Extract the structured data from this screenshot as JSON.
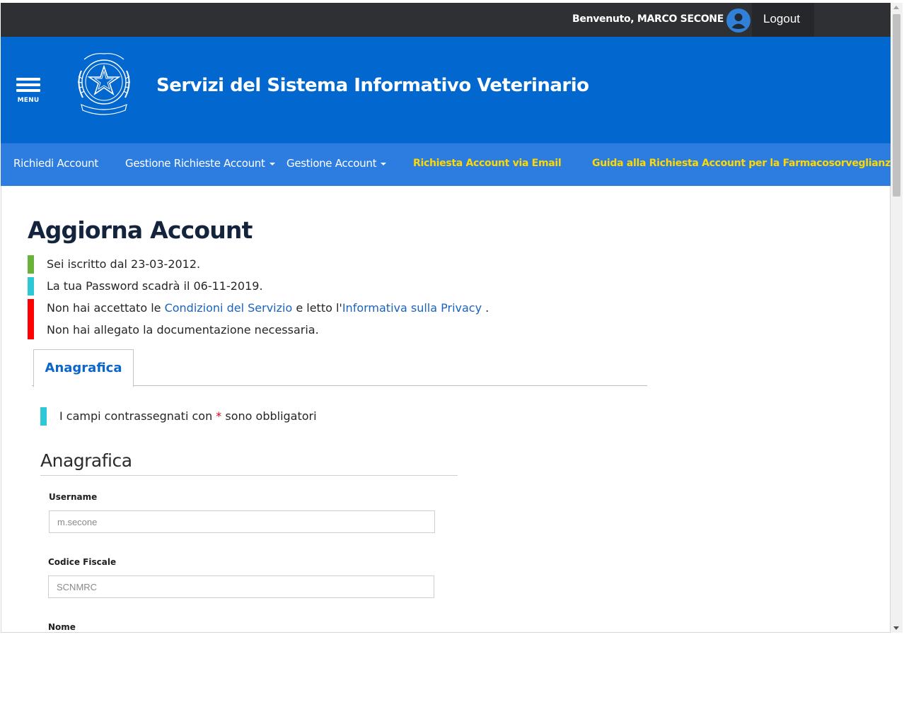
{
  "topbar": {
    "welcome": "Benvenuto, MARCO SECONE",
    "logout": "Logout"
  },
  "header": {
    "menu_label": "MENU",
    "title": "Servizi del Sistema Informativo Veterinario",
    "emblem_icon": "repubblica-italiana-emblem"
  },
  "nav": {
    "items": [
      {
        "label": "Richiedi Account"
      },
      {
        "label": "Gestione Richieste Account"
      },
      {
        "label": "Gestione Account"
      },
      {
        "label": "Richiesta Account via Email"
      },
      {
        "label": "Guida alla Richiesta Account per la Farmacosorveglianza"
      }
    ]
  },
  "page": {
    "title": "Aggiorna Account",
    "alerts": [
      {
        "text": "Sei iscritto dal 23-03-2012.",
        "color": "#6ab33b"
      },
      {
        "text": "La tua Password scadrà il 06-11-2019.",
        "color": "#2ec7d6"
      },
      {
        "pre": "Non hai accettato le ",
        "link1": "Condizioni del Servizio",
        "mid": " e letto l'",
        "link2": "Informativa sulla Privacy",
        "post": " .",
        "color": "#ff0000"
      },
      {
        "text": "Non hai allegato la documentazione necessaria.",
        "color": "#ff0000"
      }
    ],
    "tab": "Anagrafica",
    "required_note_pre": "I campi contrassegnati con ",
    "required_star": "*",
    "required_note_post": " sono obbligatori",
    "section_title": "Anagrafica",
    "fields": [
      {
        "label": "Username",
        "value": "m.secone"
      },
      {
        "label": "Codice Fiscale",
        "value": "SCNMRC"
      },
      {
        "label": "Nome"
      }
    ]
  },
  "colors": {
    "topbar": "#2f3033",
    "header": "#0267cf",
    "navbar": "#2d7de0",
    "nav_highlight": "#ffd800",
    "link": "#1c63bb"
  }
}
